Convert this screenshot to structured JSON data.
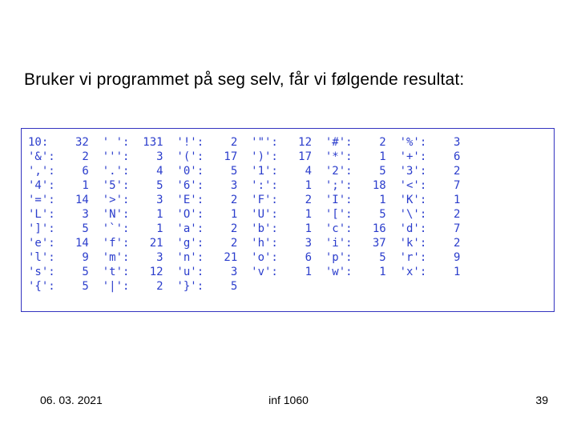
{
  "heading": "Bruker vi programmet på seg selv, får vi følgende resultat:",
  "footer": {
    "date": "06. 03. 2021",
    "course": "inf 1060",
    "page": "39"
  },
  "chart_data": {
    "type": "table",
    "title": "Character frequency output",
    "columns_per_row": 5,
    "rows": [
      [
        {
          "label": "10:",
          "value": 32
        },
        {
          "label": "' ':",
          "value": 131
        },
        {
          "label": "'!':",
          "value": 2
        },
        {
          "label": "'\"':",
          "value": 12
        },
        {
          "label": "'#':",
          "value": 2
        },
        {
          "label": "'%':",
          "value": 3
        }
      ],
      [
        {
          "label": "'&':",
          "value": 2
        },
        {
          "label": "''':",
          "value": 3
        },
        {
          "label": "'(':",
          "value": 17
        },
        {
          "label": "')':",
          "value": 17
        },
        {
          "label": "'*':",
          "value": 1
        },
        {
          "label": "'+':",
          "value": 6
        }
      ],
      [
        {
          "label": "',':",
          "value": 6
        },
        {
          "label": "'.':",
          "value": 4
        },
        {
          "label": "'0':",
          "value": 5
        },
        {
          "label": "'1':",
          "value": 4
        },
        {
          "label": "'2':",
          "value": 5
        },
        {
          "label": "'3':",
          "value": 2
        }
      ],
      [
        {
          "label": "'4':",
          "value": 1
        },
        {
          "label": "'5':",
          "value": 5
        },
        {
          "label": "'6':",
          "value": 3
        },
        {
          "label": "':':",
          "value": 1
        },
        {
          "label": "';':",
          "value": 18
        },
        {
          "label": "'<':",
          "value": 7
        }
      ],
      [
        {
          "label": "'=':",
          "value": 14
        },
        {
          "label": "'>':",
          "value": 3
        },
        {
          "label": "'E':",
          "value": 2
        },
        {
          "label": "'F':",
          "value": 2
        },
        {
          "label": "'I':",
          "value": 1
        },
        {
          "label": "'K':",
          "value": 1
        }
      ],
      [
        {
          "label": "'L':",
          "value": 3
        },
        {
          "label": "'N':",
          "value": 1
        },
        {
          "label": "'O':",
          "value": 1
        },
        {
          "label": "'U':",
          "value": 1
        },
        {
          "label": "'[':",
          "value": 5
        },
        {
          "label": "'\\':",
          "value": 2
        }
      ],
      [
        {
          "label": "']':",
          "value": 5
        },
        {
          "label": "'`':",
          "value": 1
        },
        {
          "label": "'a':",
          "value": 2
        },
        {
          "label": "'b':",
          "value": 1
        },
        {
          "label": "'c':",
          "value": 16
        },
        {
          "label": "'d':",
          "value": 7
        }
      ],
      [
        {
          "label": "'e':",
          "value": 14
        },
        {
          "label": "'f':",
          "value": 21
        },
        {
          "label": "'g':",
          "value": 2
        },
        {
          "label": "'h':",
          "value": 3
        },
        {
          "label": "'i':",
          "value": 37
        },
        {
          "label": "'k':",
          "value": 2
        }
      ],
      [
        {
          "label": "'l':",
          "value": 9
        },
        {
          "label": "'m':",
          "value": 3
        },
        {
          "label": "'n':",
          "value": 21
        },
        {
          "label": "'o':",
          "value": 6
        },
        {
          "label": "'p':",
          "value": 5
        },
        {
          "label": "'r':",
          "value": 9
        }
      ],
      [
        {
          "label": "'s':",
          "value": 5
        },
        {
          "label": "'t':",
          "value": 12
        },
        {
          "label": "'u':",
          "value": 3
        },
        {
          "label": "'v':",
          "value": 1
        },
        {
          "label": "'w':",
          "value": 1
        },
        {
          "label": "'x':",
          "value": 1
        }
      ],
      [
        {
          "label": "'{':",
          "value": 5
        },
        {
          "label": "'|':",
          "value": 2
        },
        {
          "label": "'}':",
          "value": 5
        }
      ]
    ]
  }
}
